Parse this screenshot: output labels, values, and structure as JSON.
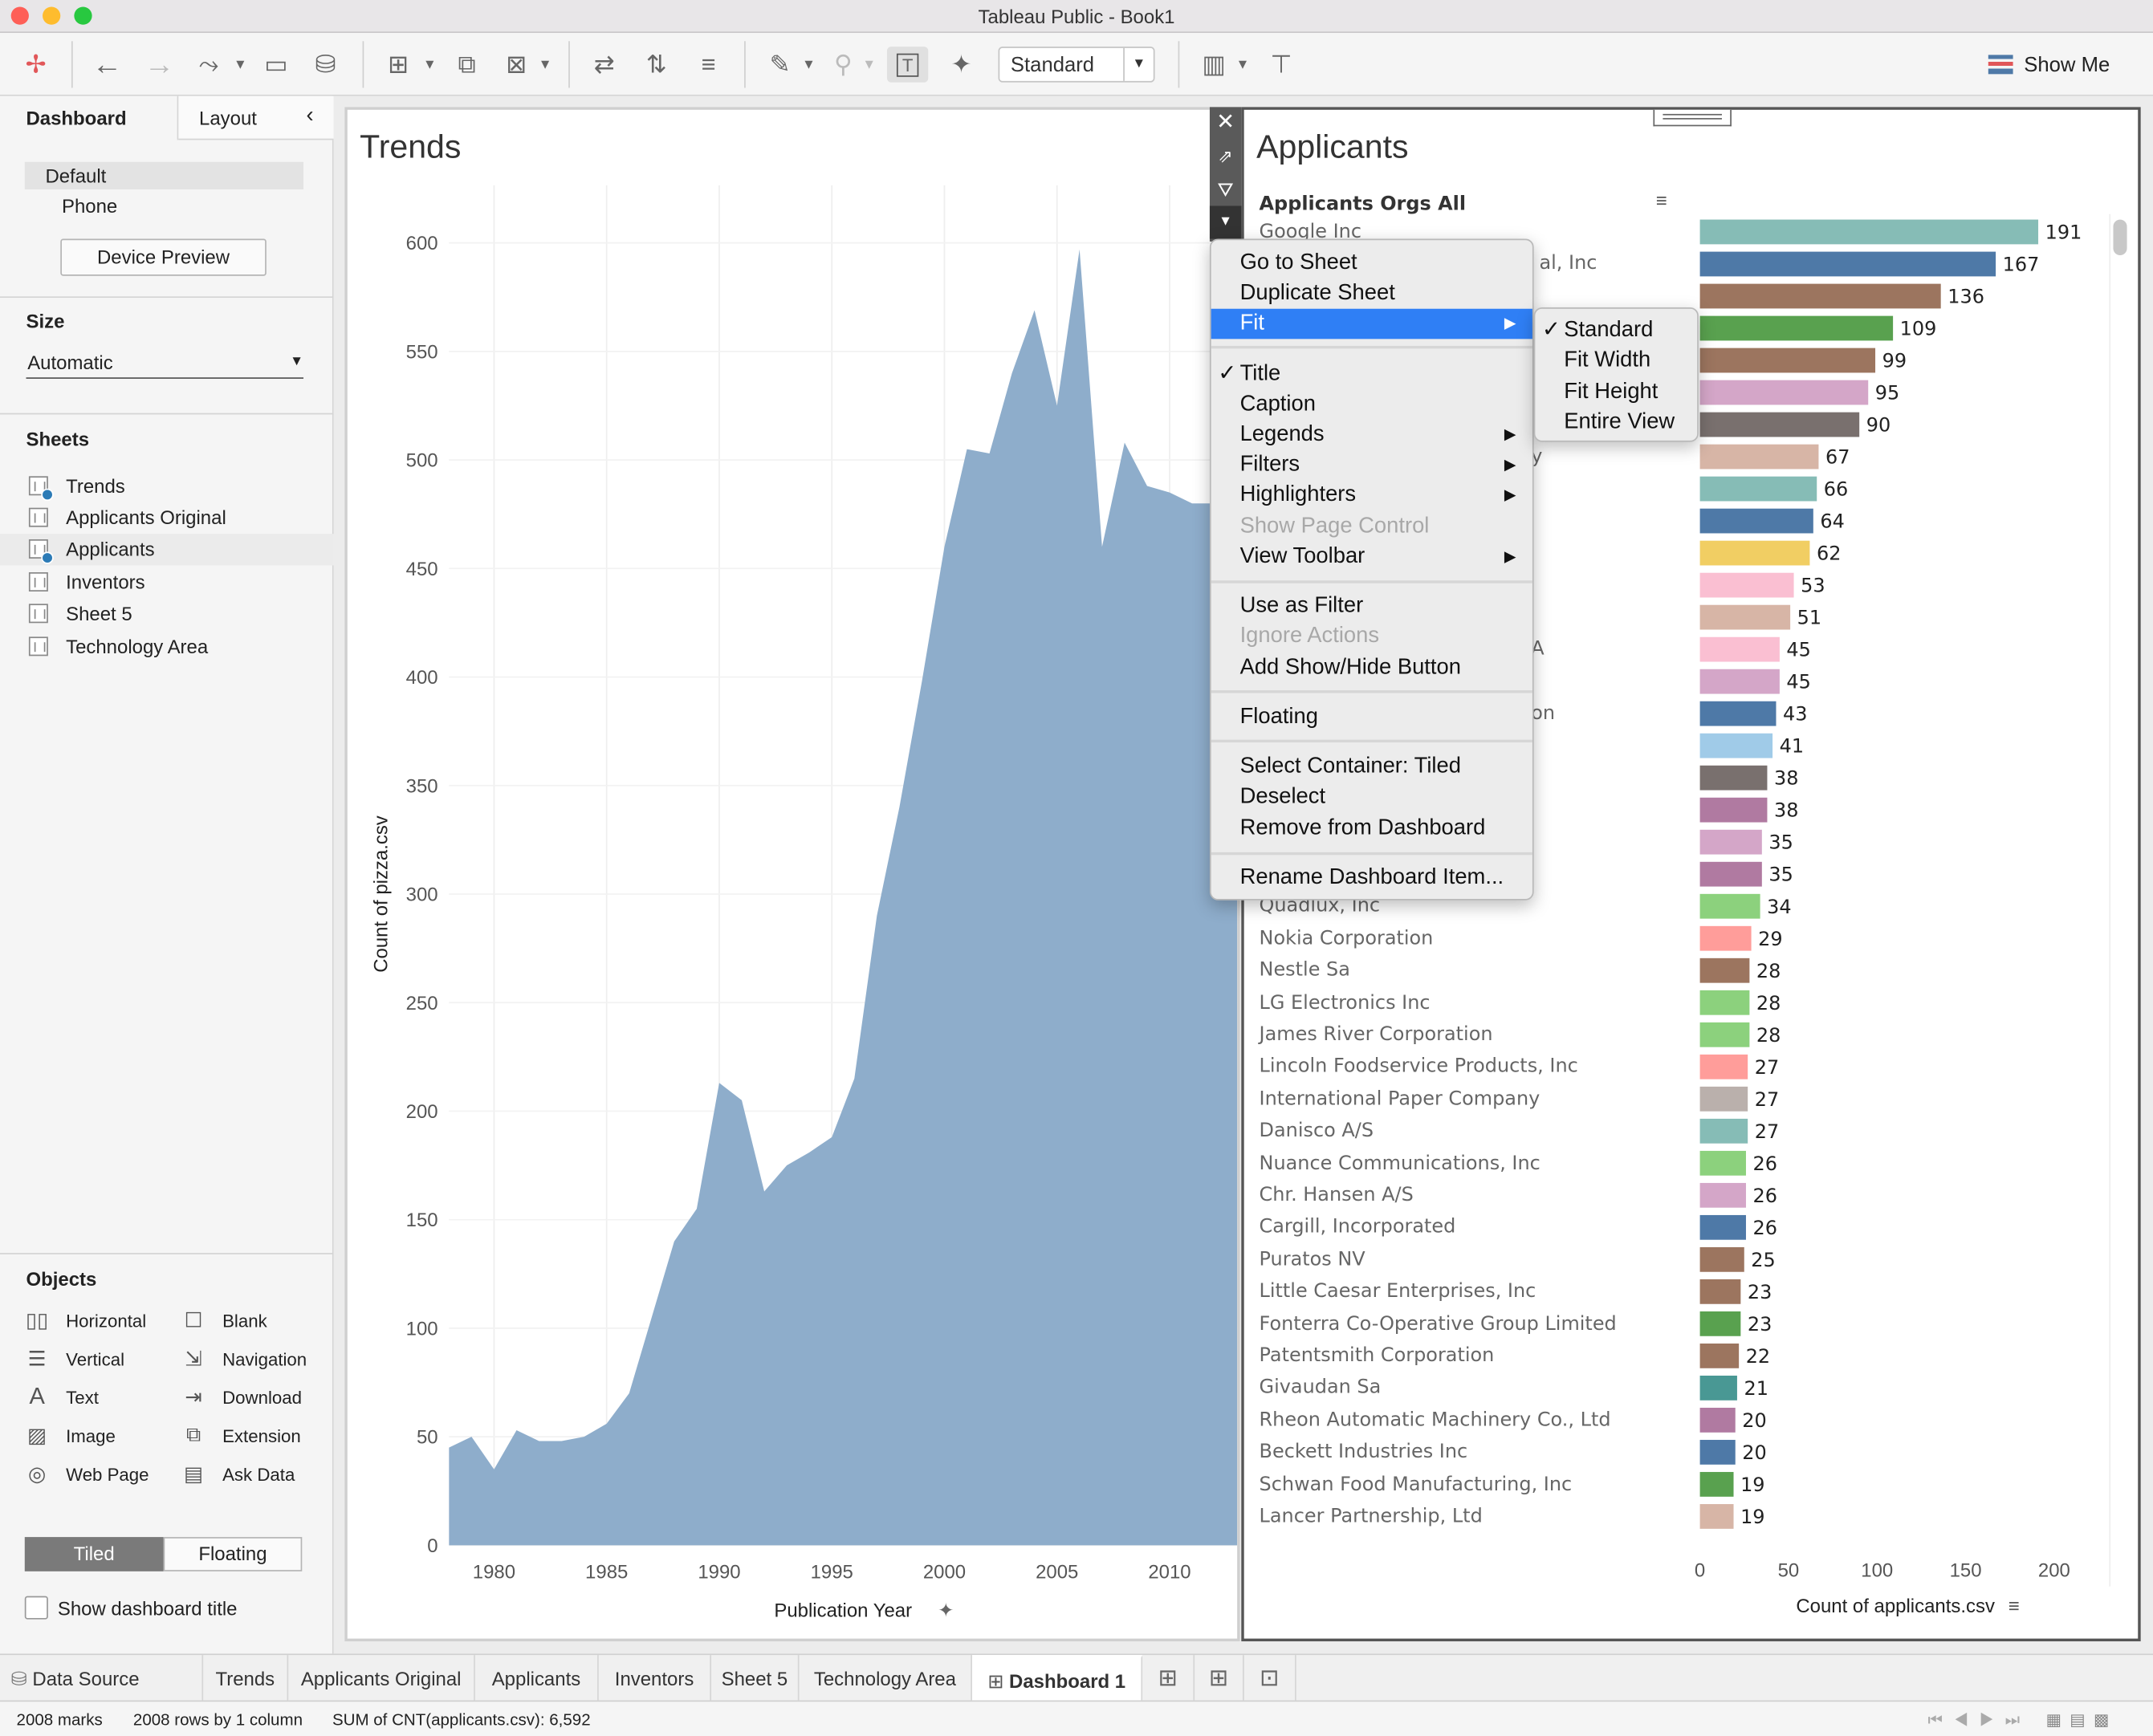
{
  "window": {
    "title": "Tableau Public - Book1"
  },
  "toolbar": {
    "mark_fit": "Standard",
    "show_me": "Show Me"
  },
  "left_panel": {
    "tabs": [
      "Dashboard",
      "Layout"
    ],
    "devices": [
      "Default",
      "Phone"
    ],
    "device_preview": "Device Preview",
    "size_label": "Size",
    "size_value": "Automatic",
    "sheets_label": "Sheets",
    "sheets": [
      "Trends",
      "Applicants Original",
      "Applicants",
      "Inventors",
      "Sheet 5",
      "Technology Area"
    ],
    "objects_label": "Objects",
    "objects": [
      "Horizontal",
      "Blank",
      "Vertical",
      "Navigation",
      "Text",
      "Download",
      "Image",
      "Extension",
      "Web Page",
      "Ask Data"
    ],
    "tiled": "Tiled",
    "floating": "Floating",
    "show_title": "Show dashboard title"
  },
  "trends": {
    "title": "Trends",
    "chart_data": {
      "type": "area",
      "x_label": "Publication Year",
      "y_label": "Count of pizza.csv",
      "xlim": [
        1978,
        2013
      ],
      "ylim": [
        0,
        600
      ],
      "x_ticks": [
        1980,
        1985,
        1990,
        1995,
        2000,
        2005,
        2010
      ],
      "y_ticks": [
        0,
        50,
        100,
        150,
        200,
        250,
        300,
        350,
        400,
        450,
        500,
        550,
        600
      ],
      "color": "#8eadcb",
      "x": [
        1977.5,
        1978,
        1979,
        1980,
        1981,
        1982,
        1983,
        1984,
        1985,
        1986,
        1987,
        1988,
        1989,
        1990,
        1991,
        1992,
        1993,
        1994,
        1995,
        1996,
        1997,
        1998,
        1999,
        2000,
        2001,
        2002,
        2003,
        2004,
        2005,
        2006,
        2007,
        2008,
        2009,
        2010,
        2011,
        2012,
        2013
      ],
      "values": [
        43,
        45,
        50,
        35,
        53,
        48,
        48,
        50,
        56,
        70,
        105,
        140,
        155,
        213,
        205,
        163,
        175,
        181,
        188,
        215,
        290,
        340,
        398,
        460,
        505,
        503,
        540,
        569,
        525,
        597,
        460,
        508,
        488,
        485,
        480,
        480,
        480
      ]
    }
  },
  "applicants": {
    "title": "Applicants",
    "column_header": "Applicants Orgs All",
    "chart_data": {
      "type": "bar",
      "orientation": "horizontal",
      "x_label": "Count of applicants.csv",
      "xlim": [
        0,
        200
      ],
      "x_ticks": [
        0,
        50,
        100,
        150,
        200
      ],
      "categories": [
        "Google Inc",
        "al, Inc",
        "",
        "",
        "",
        "",
        "",
        "y",
        "",
        "",
        "",
        "",
        "",
        "A",
        "",
        "on",
        "",
        "",
        "",
        "",
        "",
        "Quadlux, Inc",
        "Nokia Corporation",
        "Nestle Sa",
        "LG Electronics Inc",
        "James River Corporation",
        "Lincoln Foodservice Products, Inc",
        "International Paper Company",
        "Danisco A/S",
        "Nuance Communications, Inc",
        "Chr. Hansen A/S",
        "Cargill, Incorporated",
        "Puratos NV",
        "Little Caesar Enterprises, Inc",
        "Fonterra Co-Operative Group Limited",
        "Patentsmith Corporation",
        "Givaudan Sa",
        "Rheon Automatic Machinery Co., Ltd",
        "Beckett Industries Inc",
        "Schwan Food Manufacturing, Inc",
        "Lancer Partnership, Ltd"
      ],
      "values": [
        191,
        167,
        136,
        109,
        99,
        95,
        90,
        67,
        66,
        64,
        62,
        53,
        51,
        45,
        45,
        43,
        41,
        38,
        38,
        35,
        35,
        34,
        29,
        28,
        28,
        28,
        27,
        27,
        27,
        26,
        26,
        26,
        25,
        23,
        23,
        22,
        21,
        20,
        20,
        19,
        19
      ],
      "value_labels": [
        "191",
        "167",
        "136",
        "109",
        "99",
        "95",
        "90",
        "67",
        "66",
        "64",
        "62",
        "53",
        "51",
        "45",
        "45",
        "43",
        "41",
        "38",
        "38",
        "35",
        "35",
        "34",
        "29",
        "28",
        "28",
        "28",
        "27",
        "27",
        "27",
        "26",
        "26",
        "26",
        "25",
        "23",
        "23",
        "22",
        "21",
        "20",
        "20",
        "19",
        "19"
      ],
      "colors": [
        "#86bcb6",
        "#4e79a7",
        "#9c755f",
        "#59a14f",
        "#9c755f",
        "#d4a6c8",
        "#79706e",
        "#d7b5a6",
        "#86bcb6",
        "#4e79a7",
        "#f1ce63",
        "#fabfd2",
        "#d7b5a6",
        "#fabfd2",
        "#d4a6c8",
        "#4e79a7",
        "#a0cbe8",
        "#79706e",
        "#b07aa1",
        "#d4a6c8",
        "#b07aa1",
        "#8cd17d",
        "#ff9d9a",
        "#9c755f",
        "#8cd17d",
        "#8cd17d",
        "#ff9d9a",
        "#bab0ac",
        "#86bcb6",
        "#8cd17d",
        "#d4a6c8",
        "#4e79a7",
        "#9c755f",
        "#9c755f",
        "#59a14f",
        "#9c755f",
        "#499894",
        "#b07aa1",
        "#4e79a7",
        "#59a14f",
        "#d7b5a6"
      ]
    }
  },
  "context_menu": {
    "items": [
      "Go to Sheet",
      "Duplicate Sheet",
      "Fit",
      "Title",
      "Caption",
      "Legends",
      "Filters",
      "Highlighters",
      "Show Page Control",
      "View Toolbar",
      "Use as Filter",
      "Ignore Actions",
      "Add Show/Hide Button",
      "Floating",
      "Select Container: Tiled",
      "Deselect",
      "Remove from Dashboard",
      "Rename Dashboard Item..."
    ],
    "submenu": [
      "Standard",
      "Fit Width",
      "Fit Height",
      "Entire View"
    ]
  },
  "sheet_tabs": [
    "Data Source",
    "Trends",
    "Applicants Original",
    "Applicants",
    "Inventors",
    "Sheet 5",
    "Technology Area",
    "Dashboard 1"
  ],
  "status": {
    "marks": "2008 marks",
    "rows": "2008 rows by 1 column",
    "sum": "SUM of CNT(applicants.csv): 6,592"
  }
}
